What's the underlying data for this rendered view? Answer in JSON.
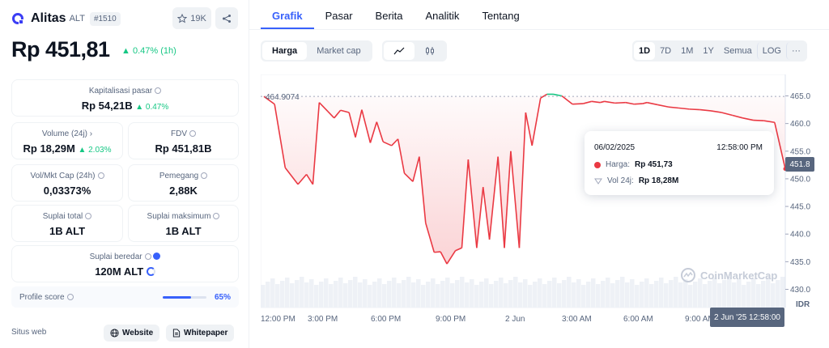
{
  "coin": {
    "name": "Alitas",
    "symbol": "ALT",
    "rank": "#1510",
    "watchlist_count": "19K",
    "price": "Rp 451,81",
    "price_change": "0.47% (1h)"
  },
  "stats": {
    "market_cap": {
      "label": "Kapitalisasi pasar",
      "value": "Rp 54,21B",
      "change": "0.47%"
    },
    "volume": {
      "label": "Volume (24j)",
      "value": "Rp 18,29M",
      "change": "2.03%"
    },
    "fdv": {
      "label": "FDV",
      "value": "Rp 451,81B"
    },
    "vol_mkt_cap": {
      "label": "Vol/Mkt Cap (24h)",
      "value": "0,03373%"
    },
    "holders": {
      "label": "Pemegang",
      "value": "2,88K"
    },
    "total_supply": {
      "label": "Suplai total",
      "value": "1B ALT"
    },
    "max_supply": {
      "label": "Suplai maksimum",
      "value": "1B ALT"
    },
    "circulating": {
      "label": "Suplai beredar",
      "value": "120M ALT"
    }
  },
  "profile": {
    "label": "Profile score",
    "value": "65%",
    "fraction": 0.65
  },
  "links": {
    "label": "Situs web",
    "website": "Website",
    "whitepaper": "Whitepaper"
  },
  "tabs": [
    "Grafik",
    "Pasar",
    "Berita",
    "Analitik",
    "Tentang"
  ],
  "chart_toggle": [
    "Harga",
    "Market cap"
  ],
  "ranges": [
    "1D",
    "7D",
    "1M",
    "1Y",
    "Semua",
    "LOG"
  ],
  "tooltip": {
    "date": "06/02/2025",
    "time": "12:58:00 PM",
    "price_label": "Harga:",
    "price_value": "Rp 451,73",
    "vol_label": "Vol 24j:",
    "vol_value": "Rp 18,28M"
  },
  "current_price_tag": "451.8",
  "crosshair_time": "2 Jun '25 12:58:00",
  "currency": "IDR",
  "watermark": "CoinMarketCap",
  "colors": {
    "up": "#16c784",
    "down": "#ea3943",
    "accent": "#3861fb"
  },
  "chart_data": {
    "type": "line",
    "ylim": [
      427,
      468
    ],
    "yticks": [
      "465.0",
      "460.0",
      "455.0",
      "450.0",
      "445.0",
      "440.0",
      "435.0",
      "430.0"
    ],
    "xticks": [
      "12:00 PM",
      "3:00 PM",
      "6:00 PM",
      "9:00 PM",
      "2 Jun",
      "3:00 AM",
      "6:00 AM",
      "9:00 AM"
    ],
    "reference_line": "464.9074",
    "x": [
      0,
      0.5,
      1,
      1.6,
      2,
      2.3,
      2.6,
      3,
      3.3,
      3.6,
      4,
      4.3,
      4.6,
      5,
      5.3,
      5.6,
      6,
      6.3,
      6.6,
      7,
      7.3,
      7.6,
      8,
      8.3,
      8.6,
      9,
      9.3,
      9.6,
      10,
      10.3,
      10.6,
      11,
      11.3,
      11.6,
      12,
      12.3,
      12.6,
      13,
      13.3,
      13.6,
      14,
      14.5,
      15,
      15.4,
      15.8,
      16,
      16.5,
      17,
      17.4,
      17.8,
      18,
      18.5,
      19,
      19.5,
      20,
      20.5,
      21,
      21.5,
      22,
      22.5,
      23,
      23.5,
      24,
      24.5
    ],
    "values": [
      464.9,
      463.5,
      452,
      449,
      450.8,
      449,
      463.8,
      462.2,
      461,
      462.4,
      462,
      457.5,
      462.5,
      456.5,
      460.3,
      456.7,
      456,
      457.2,
      451,
      449.5,
      454,
      442,
      436.7,
      436.8,
      434.6,
      437,
      437.5,
      453.5,
      437.5,
      448.5,
      439,
      454,
      437.5,
      455,
      437.5,
      462,
      456,
      464.6,
      465.3,
      465.3,
      465,
      463.5,
      463.6,
      464,
      463.8,
      464,
      463.7,
      463.8,
      463.5,
      463.6,
      463.8,
      463.4,
      463,
      462.8,
      462.6,
      462.5,
      462.3,
      462,
      461.5,
      461,
      460.6,
      460.5,
      460.2,
      451.8
    ],
    "colors": {
      "up": "#16c784",
      "down": "#ea3943"
    }
  }
}
